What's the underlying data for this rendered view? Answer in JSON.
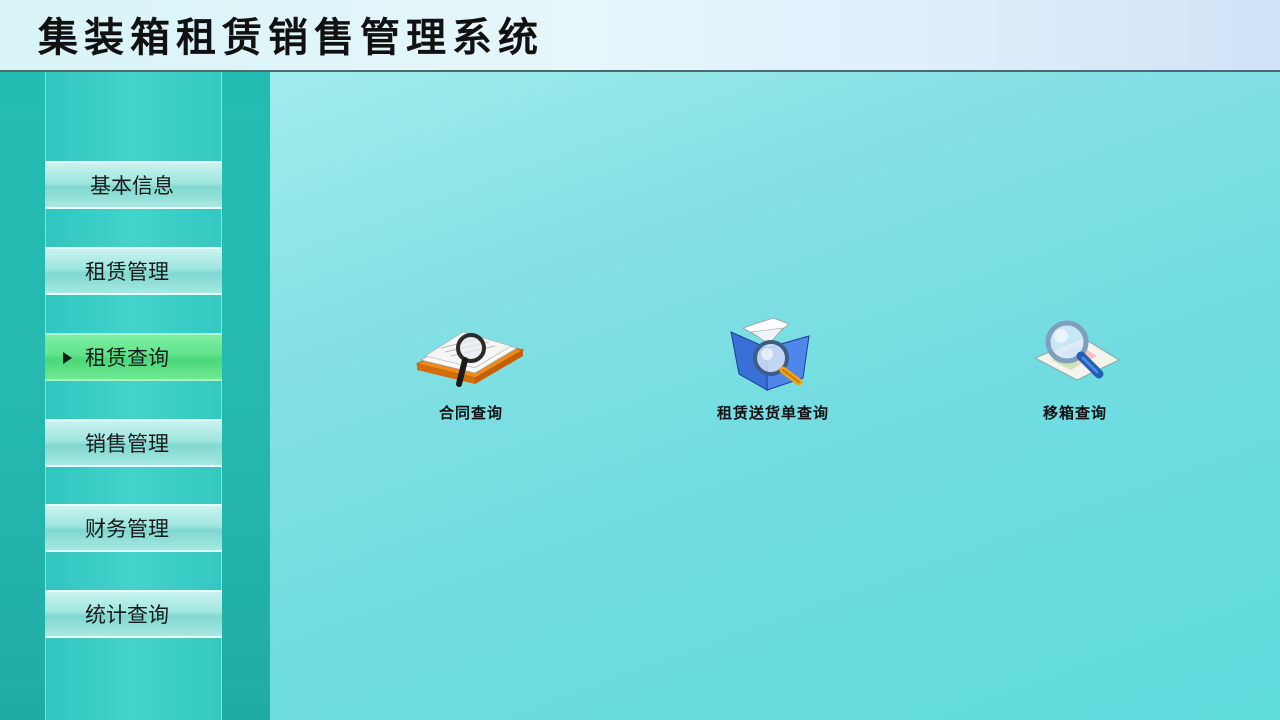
{
  "header": {
    "title": "集装箱租赁销售管理系统"
  },
  "sidebar": {
    "items": [
      {
        "label": "基本信息",
        "active": false
      },
      {
        "label": "租赁管理",
        "active": false
      },
      {
        "label": "租赁查询",
        "active": true
      },
      {
        "label": "销售管理",
        "active": false
      },
      {
        "label": "财务管理",
        "active": false
      },
      {
        "label": "统计查询",
        "active": false
      }
    ]
  },
  "main": {
    "tiles": [
      {
        "label": "合同查询",
        "icon": "contract-search-icon"
      },
      {
        "label": "租赁送货单查询",
        "icon": "delivery-note-search-icon"
      },
      {
        "label": "移箱查询",
        "icon": "container-move-search-icon"
      }
    ]
  },
  "colors": {
    "sidebar": "#26b9b0",
    "active_item": "#5fe38a",
    "main_bg": "#7fdede"
  }
}
